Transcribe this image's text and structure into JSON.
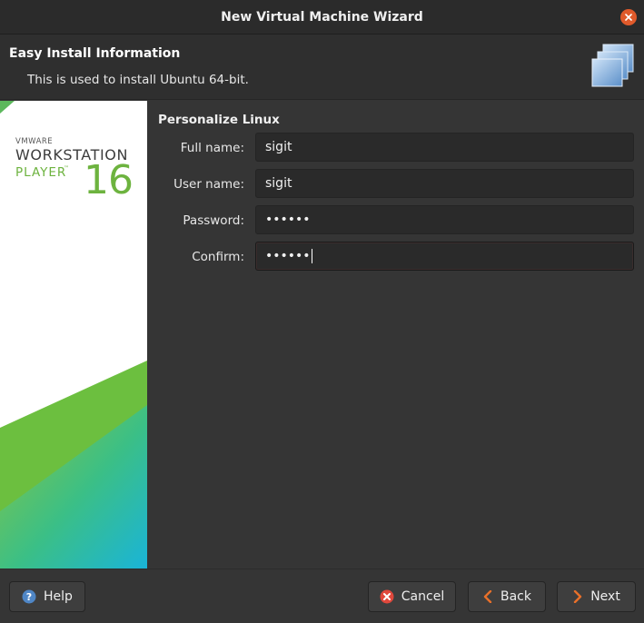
{
  "window": {
    "title": "New Virtual Machine Wizard"
  },
  "header": {
    "title": "Easy Install Information",
    "subtitle": "This is used to install Ubuntu 64-bit."
  },
  "branding": {
    "vendor": "VMWARE",
    "product_line1": "WORKSTATION",
    "product_line2": "PLAYER",
    "trademark": "™",
    "version": "16",
    "accent_color": "#6db33f"
  },
  "form": {
    "section_title": "Personalize Linux",
    "fields": [
      {
        "label": "Full name:",
        "value": "sigit"
      },
      {
        "label": "User name:",
        "value": "sigit"
      },
      {
        "label": "Password:",
        "value": "••••••"
      },
      {
        "label": "Confirm:",
        "value": "••••••"
      }
    ]
  },
  "buttons": {
    "help": "Help",
    "cancel": "Cancel",
    "back": "Back",
    "next": "Next"
  },
  "icons": {
    "close": "close-icon",
    "help": "help-icon",
    "cancel": "cancel-icon",
    "back": "chevron-left-icon",
    "next": "chevron-right-icon",
    "vm": "virtual-machine-icon"
  },
  "colors": {
    "close_button": "#e05a2b",
    "chevron": "#e8702a",
    "cancel_icon": "#e0483c",
    "help_icon": "#4f86c6"
  }
}
